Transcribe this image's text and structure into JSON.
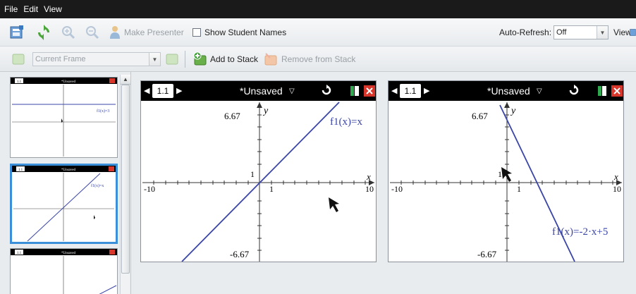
{
  "menu": {
    "file": "File",
    "edit": "Edit",
    "view": "View"
  },
  "toolbar": {
    "make_presenter": "Make Presenter",
    "show_student_names": "Show Student Names",
    "auto_refresh_label": "Auto-Refresh:",
    "auto_refresh_value": "Off",
    "view_label": "View"
  },
  "toolbar2": {
    "frame_select": "Current Frame",
    "add_to_stack": "Add to Stack",
    "remove_from_stack": "Remove from Stack"
  },
  "calculator": {
    "tab": "1.1",
    "doc_title": "*Unsaved",
    "ymax": "6.67",
    "ymin": "-6.67",
    "xmin": "-10",
    "xmax": "10",
    "one": "1",
    "yaxis": "y",
    "xaxis": "x"
  },
  "panels": [
    {
      "func": "f1(x)=x"
    },
    {
      "func": "f1(x)=-2·x+5"
    }
  ],
  "thumbnails": [
    {
      "func": "f1(x)=3"
    },
    {
      "func": "f1(x)=x"
    },
    {
      "func": ""
    }
  ],
  "colors": {
    "plot": "#3a45a8",
    "selected": "#3b8fd8",
    "menubar": "#1a1a1a"
  }
}
